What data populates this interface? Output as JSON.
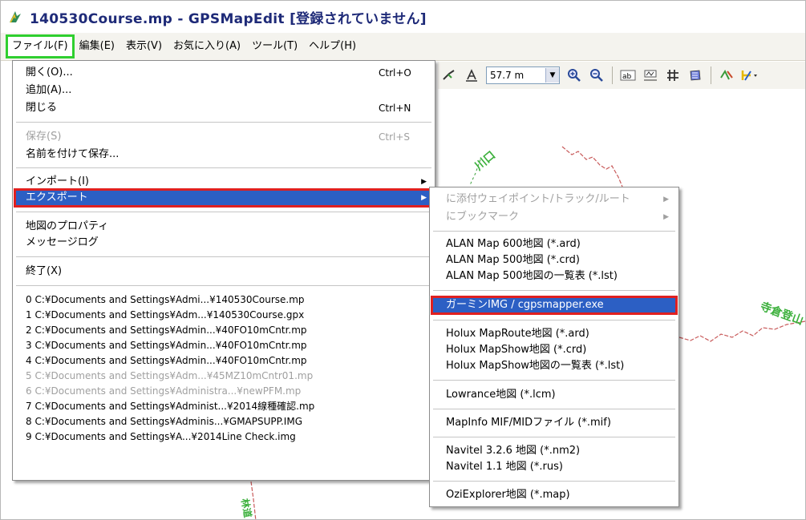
{
  "window": {
    "title": "140530Course.mp - GPSMapEdit [登録されていません]"
  },
  "menubar": [
    {
      "label": "ファイル(F)"
    },
    {
      "label": "編集(E)"
    },
    {
      "label": "表示(V)"
    },
    {
      "label": "お気に入り(A)"
    },
    {
      "label": "ツール(T)"
    },
    {
      "label": "ヘルプ(H)"
    }
  ],
  "toolbar": {
    "zoom_value": "57.7 m"
  },
  "file_menu": {
    "items": [
      {
        "label": "開く(O)...",
        "shortcut": "Ctrl+O"
      },
      {
        "label": "追加(A)..."
      },
      {
        "label": "閉じる",
        "shortcut": "Ctrl+N"
      },
      {
        "label": "保存(S)",
        "shortcut": "Ctrl+S"
      },
      {
        "label": "名前を付けて保存..."
      },
      {
        "label": "インポート(I)"
      },
      {
        "label": "エクスポート"
      },
      {
        "label": "地図のプロパティ"
      },
      {
        "label": "メッセージログ"
      },
      {
        "label": "終了(X)"
      }
    ],
    "recent": [
      "0 C:¥Documents and Settings¥Admi...¥140530Course.mp",
      "1 C:¥Documents and Settings¥Adm...¥140530Course.gpx",
      "2 C:¥Documents and Settings¥Admin...¥40FO10mCntr.mp",
      "3 C:¥Documents and Settings¥Admin...¥40FO10mCntr.mp",
      "4 C:¥Documents and Settings¥Admin...¥40FO10mCntr.mp",
      "5 C:¥Documents and Settings¥Adm...¥45MZ10mCntr01.mp",
      "6 C:¥Documents and Settings¥Administra...¥newPFM.mp",
      "7 C:¥Documents and Settings¥Administ...¥2014線種確認.mp",
      "8 C:¥Documents and Settings¥Adminis...¥GMAPSUPP.IMG",
      "9 C:¥Documents and Settings¥A...¥2014Line Check.img"
    ]
  },
  "export_menu": {
    "items": [
      "に添付ウェイポイント/トラック/ルート",
      "にブックマーク",
      "ALAN Map 600地図 (*.ard)",
      "ALAN Map 500地図 (*.crd)",
      "ALAN Map 500地図の一覧表 (*.lst)",
      "ガーミンIMG / cgpsmapper.exe",
      "Holux MapRoute地図 (*.ard)",
      "Holux MapShow地図 (*.crd)",
      "Holux MapShow地図の一覧表 (*.lst)",
      "Lowrance地図 (*.lcm)",
      "MapInfo MIF/MIDファイル (*.mif)",
      "Navitel 3.2.6 地図 (*.nm2)",
      "Navitel 1.1 地図 (*.rus)",
      "OziExplorer地図 (*.map)"
    ]
  },
  "map_labels": [
    "川口",
    "寺倉登山",
    "林道"
  ],
  "colors": {
    "highlight": "#2c5fc4",
    "red_box": "#e02020",
    "green_box": "#2fcf2f",
    "route": "#c85a5a"
  }
}
